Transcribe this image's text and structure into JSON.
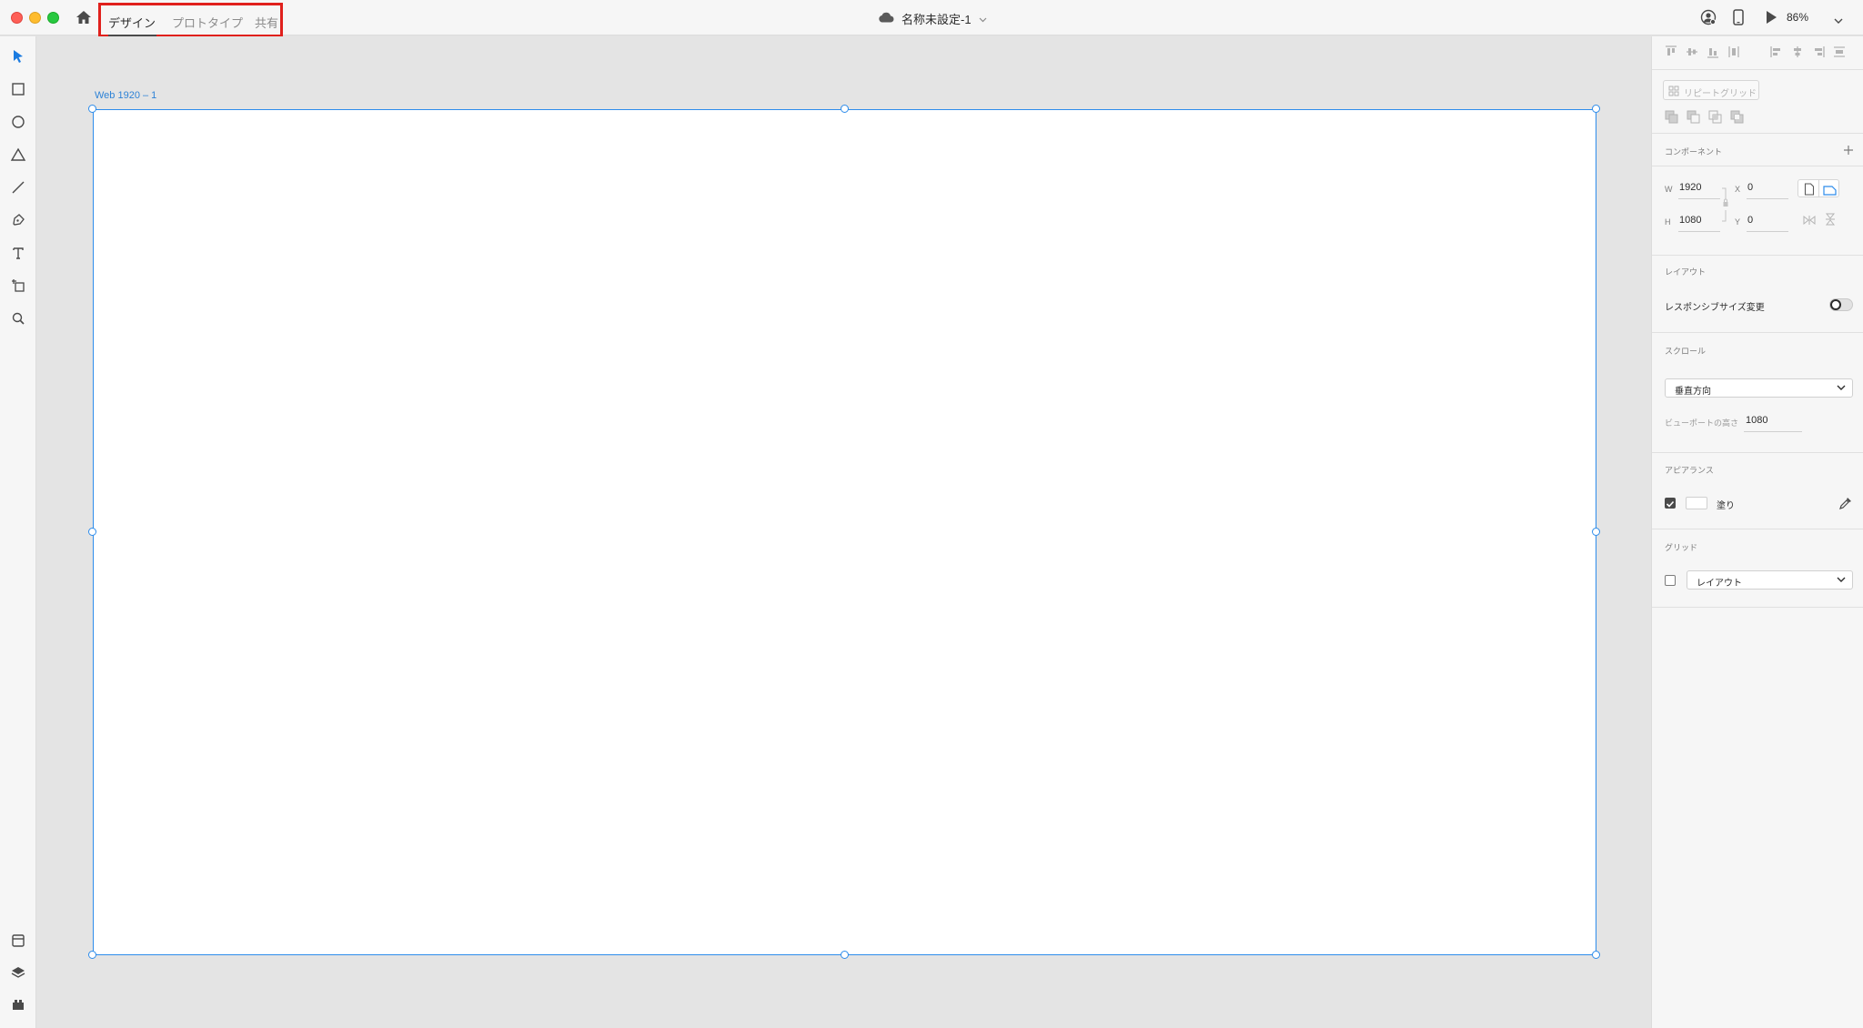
{
  "titlebar": {
    "modes": [
      {
        "label": "デザイン",
        "active": true
      },
      {
        "label": "プロトタイプ",
        "active": false
      },
      {
        "label": "共有",
        "active": false
      }
    ],
    "document_title": "名称未設定-1",
    "zoom": "86%",
    "icons": [
      "home-icon",
      "cloud-icon",
      "user-icon",
      "device-preview-icon",
      "play-icon",
      "chevron-down-icon"
    ]
  },
  "toolbar": {
    "tools": [
      "select-tool-icon",
      "rectangle-tool-icon",
      "ellipse-tool-icon",
      "polygon-tool-icon",
      "line-tool-icon",
      "pen-tool-icon",
      "text-tool-icon",
      "artboard-tool-icon",
      "zoom-tool-icon"
    ],
    "bottom": [
      "assets-icon",
      "layers-icon",
      "plugins-icon"
    ]
  },
  "canvas": {
    "artboard_label": "Web 1920 – 1"
  },
  "panel": {
    "repeat_grid_label": "リピートグリッド",
    "components_header": "コンポーネント",
    "w_label": "W",
    "w_value": "1920",
    "h_label": "H",
    "h_value": "1080",
    "x_label": "X",
    "x_value": "0",
    "y_label": "Y",
    "y_value": "0",
    "layout_header": "レイアウト",
    "responsive_label": "レスポンシブサイズ変更",
    "responsive_on": false,
    "scroll_header": "スクロール",
    "scroll_value": "垂直方向",
    "viewport_label": "ビューポートの高さ",
    "viewport_value": "1080",
    "appearance_header": "アピアランス",
    "fill_label": "塗り",
    "fill_checked": true,
    "fill_color": "#ffffff",
    "grid_header": "グリッド",
    "grid_value": "レイアウト",
    "grid_checked": false
  },
  "colors": {
    "accent": "#2d8ceb",
    "highlight_box": "#e0201c"
  }
}
